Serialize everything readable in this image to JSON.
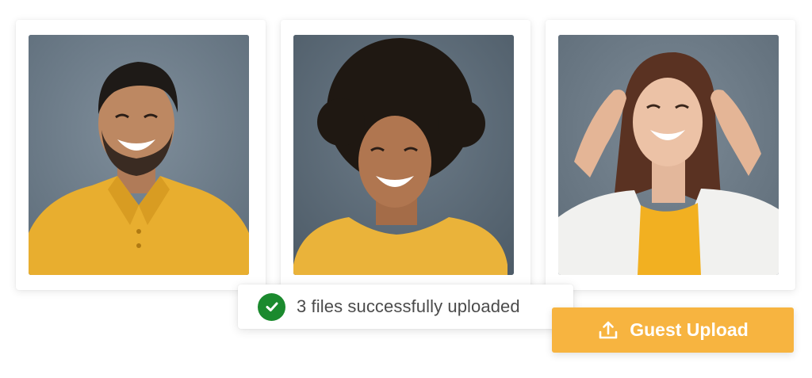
{
  "gallery": {
    "photos": [
      {
        "icon": "man-yellow-polo-photo"
      },
      {
        "icon": "woman-curly-hair-photo"
      },
      {
        "icon": "woman-white-shirt-photo"
      }
    ]
  },
  "toast": {
    "icon": "check-circle-icon",
    "message": "3 files successfully uploaded",
    "accent": "#1b8a2e"
  },
  "upload_button": {
    "icon": "upload-icon",
    "label": "Guest Upload",
    "color": "#f7b440"
  }
}
